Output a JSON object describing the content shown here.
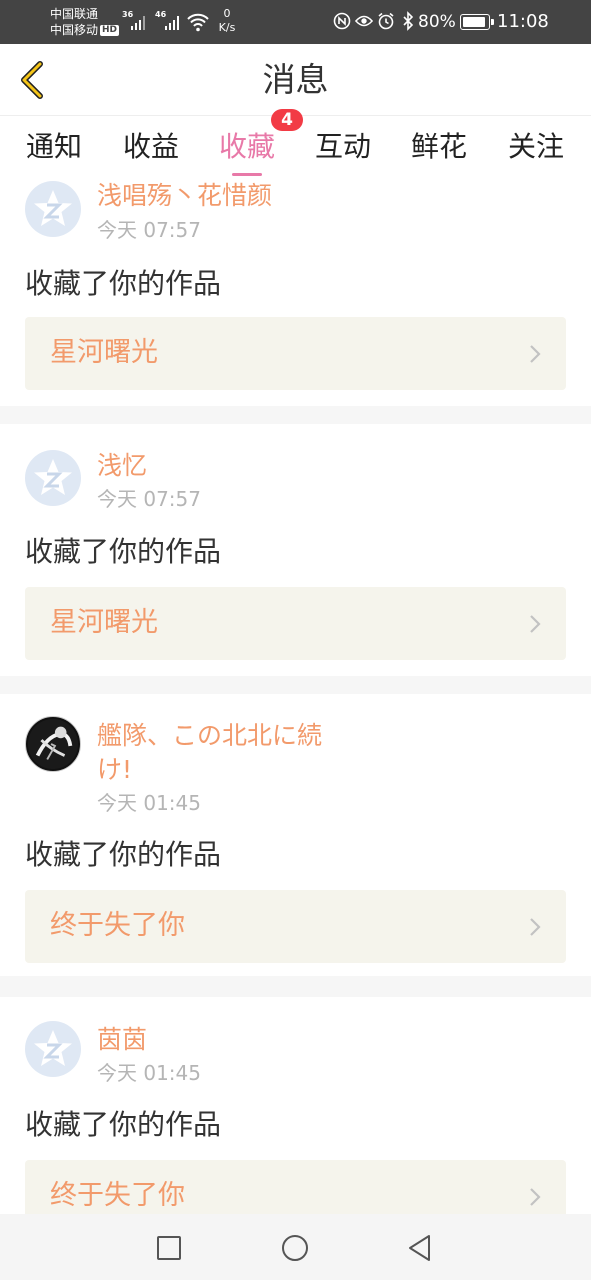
{
  "status_bar": {
    "carrier_1": "中国联通",
    "carrier_2": "中国移动",
    "hd_badge": "HD",
    "net_1": "36",
    "net_2": "46",
    "speed_value": "0",
    "speed_unit": "K/s",
    "battery": "80%",
    "battery_level": 0.8,
    "time": "11:08",
    "icons": [
      "nfc-icon",
      "eye-icon",
      "alarm-icon",
      "bluetooth-icon"
    ]
  },
  "header": {
    "title": "消息",
    "back_icon": "chevron-left-icon"
  },
  "tabs": [
    {
      "label": "通知",
      "active": false
    },
    {
      "label": "收益",
      "active": false
    },
    {
      "label": "收藏",
      "active": true,
      "badge": "4"
    },
    {
      "label": "互动",
      "active": false
    },
    {
      "label": "鲜花",
      "active": false
    },
    {
      "label": "关注",
      "active": false
    }
  ],
  "colors": {
    "accent_pink": "#e879a8",
    "badge_red": "#f23b45",
    "name_orange": "#f29a6b",
    "link_bg": "#f5f4ec"
  },
  "feed": [
    {
      "username": "浅唱殇丶花惜颜",
      "time": "今天 07:57",
      "action": "收藏了你的作品",
      "work": "星河曙光",
      "avatar": "default-avatar"
    },
    {
      "username": "浅忆",
      "time": "今天 07:57",
      "action": "收藏了你的作品",
      "work": "星河曙光",
      "avatar": "default-avatar"
    },
    {
      "username": "艦隊、この北北に続け!",
      "time": "今天 01:45",
      "action": "收藏了你的作品",
      "work": "终于失了你",
      "avatar": "photo-avatar"
    },
    {
      "username": "茵茵",
      "time": "今天 01:45",
      "action": "收藏了你的作品",
      "work": "终于失了你",
      "avatar": "default-avatar"
    }
  ],
  "nav_bar": {
    "icons": [
      "recent-apps-icon",
      "home-icon",
      "back-icon"
    ]
  }
}
